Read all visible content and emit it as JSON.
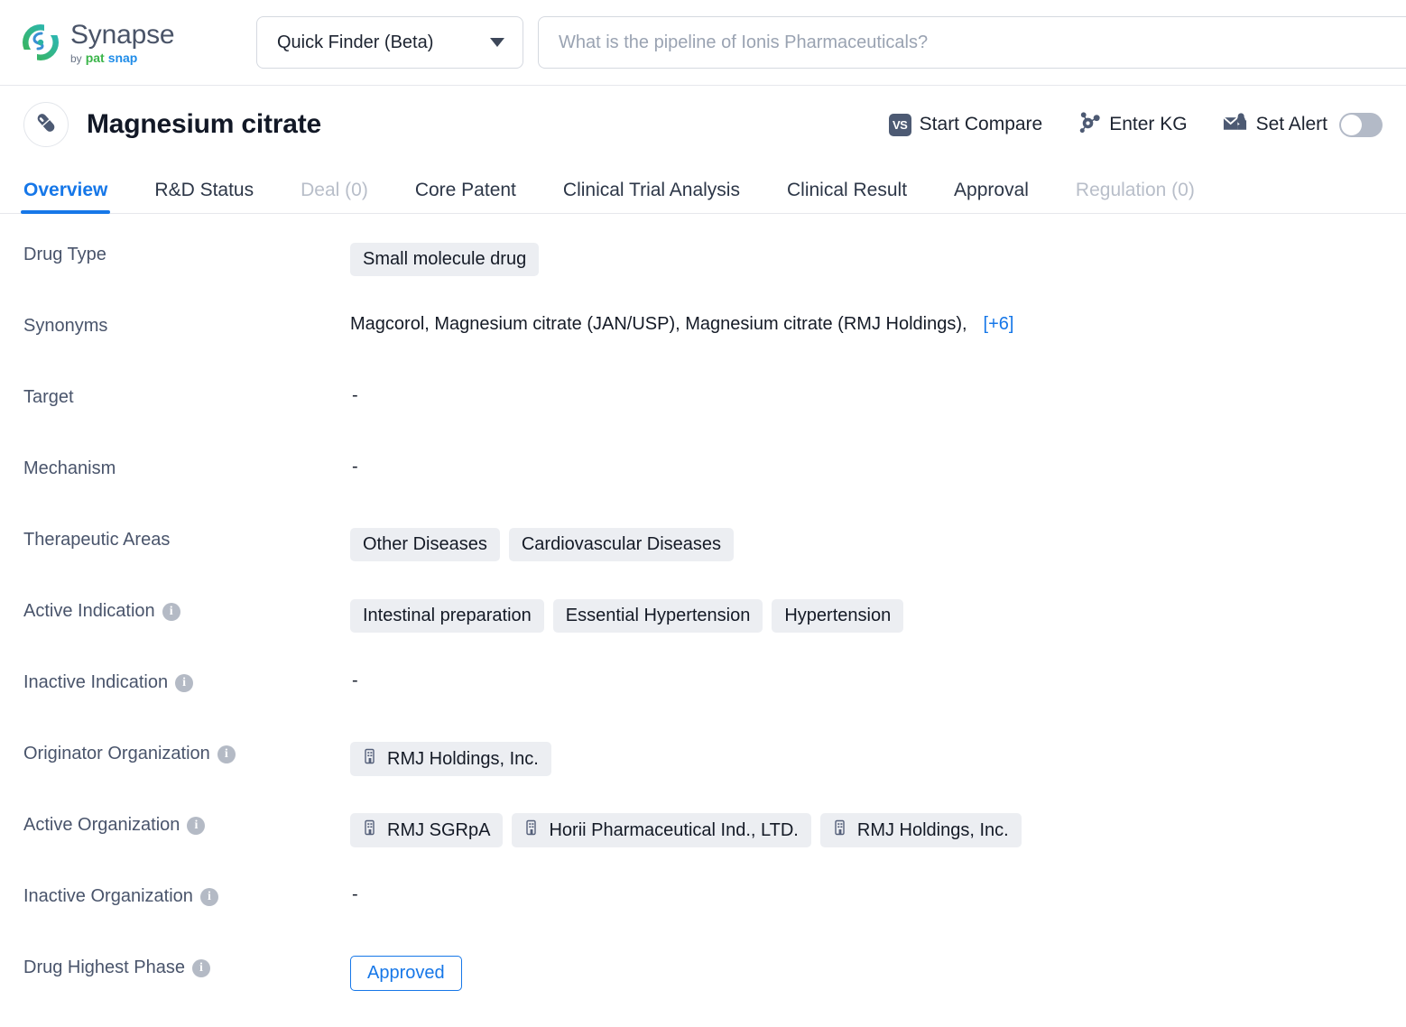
{
  "brand": {
    "name": "Synapse",
    "by": "by",
    "pat": "pat",
    "snap": "snap"
  },
  "topbar": {
    "finder_label": "Quick Finder (Beta)",
    "search_value": "",
    "search_placeholder": "What is the pipeline of Ionis Pharmaceuticals?"
  },
  "drug_header": {
    "title": "Magnesium citrate",
    "actions": [
      {
        "label": "Start Compare",
        "icon": "vs-icon"
      },
      {
        "label": "Enter KG",
        "icon": "knowledge-graph-icon"
      },
      {
        "label": "Set Alert",
        "icon": "alert-envelope-icon"
      }
    ],
    "alert_toggle_state": "off"
  },
  "tabs": [
    {
      "label": "Overview",
      "state": "active"
    },
    {
      "label": "R&D Status",
      "state": "normal"
    },
    {
      "label": "Deal (0)",
      "state": "disabled"
    },
    {
      "label": "Core Patent",
      "state": "normal"
    },
    {
      "label": "Clinical Trial Analysis",
      "state": "normal"
    },
    {
      "label": "Clinical Result",
      "state": "normal"
    },
    {
      "label": "Approval",
      "state": "normal"
    },
    {
      "label": "Regulation (0)",
      "state": "disabled"
    }
  ],
  "fields": {
    "drug_type": {
      "label": "Drug Type",
      "value": "Small molecule drug"
    },
    "synonyms": {
      "label": "Synonyms",
      "value": "Magcorol,  Magnesium citrate (JAN/USP),  Magnesium citrate (RMJ Holdings),",
      "more": "[+6]"
    },
    "target": {
      "label": "Target",
      "value": "-"
    },
    "mechanism": {
      "label": "Mechanism",
      "value": "-"
    },
    "therapeutic_areas": {
      "label": "Therapeutic Areas",
      "chips": [
        "Other Diseases",
        "Cardiovascular Diseases"
      ]
    },
    "active_indication": {
      "label": "Active Indication",
      "chips": [
        "Intestinal preparation",
        "Essential Hypertension",
        "Hypertension"
      ]
    },
    "inactive_indication": {
      "label": "Inactive Indication",
      "value": "-"
    },
    "originator_organization": {
      "label": "Originator Organization",
      "chips": [
        "RMJ Holdings, Inc."
      ]
    },
    "active_organization": {
      "label": "Active Organization",
      "chips": [
        "RMJ SGRpA",
        "Horii Pharmaceutical Ind., LTD.",
        "RMJ Holdings, Inc."
      ]
    },
    "inactive_organization": {
      "label": "Inactive Organization",
      "value": "-"
    },
    "drug_highest_phase": {
      "label": "Drug Highest Phase",
      "value": "Approved"
    }
  },
  "colors": {
    "accent_blue": "#1677e8",
    "chip_bg": "#eceef2",
    "label_gray": "#49546b",
    "brand_green": "#3bb54a",
    "brand_blue": "#1f8ce8"
  }
}
